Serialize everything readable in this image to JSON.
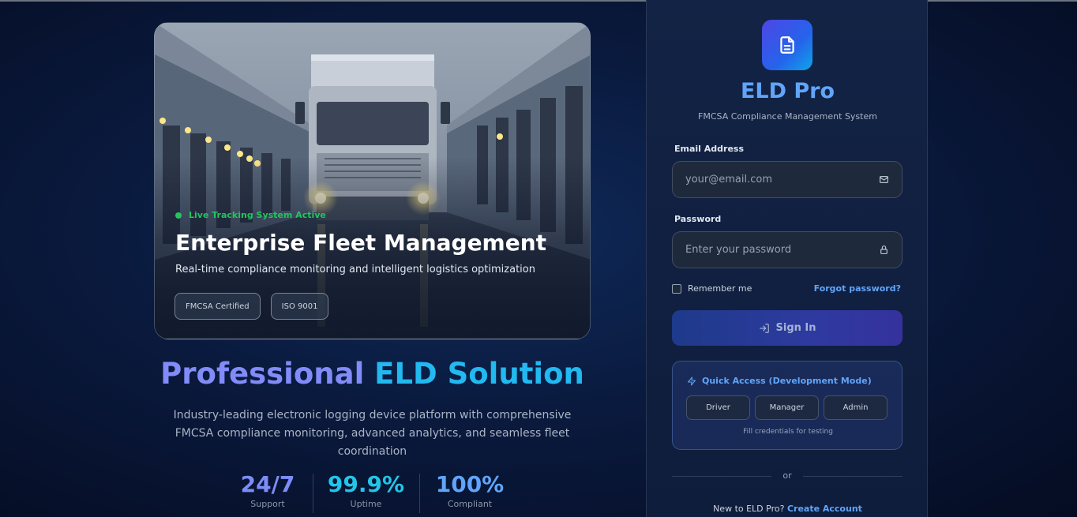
{
  "hero": {
    "live_status": "Live Tracking System Active",
    "title": "Enterprise Fleet Management",
    "subtitle": "Real-time compliance monitoring and intelligent logistics optimization",
    "badges": [
      "FMCSA Certified",
      "ISO 9001"
    ],
    "image": "truck-in-warehouse-photo"
  },
  "main": {
    "title_part1": "Professional",
    "title_part2": "ELD Solution",
    "description": "Industry-leading electronic logging device platform with comprehensive FMCSA compliance monitoring, advanced analytics, and seamless fleet coordination",
    "stats": [
      {
        "value": "24/7",
        "label": "Support"
      },
      {
        "value": "99.9%",
        "label": "Uptime"
      },
      {
        "value": "100%",
        "label": "Compliant"
      }
    ]
  },
  "login": {
    "logo_icon": "document-icon",
    "brand": "ELD Pro",
    "tagline": "FMCSA Compliance Management System",
    "email_label": "Email Address",
    "email_placeholder": "your@email.com",
    "email_icon": "mail-icon",
    "password_label": "Password",
    "password_placeholder": "Enter your password",
    "password_icon": "lock-icon",
    "remember_label": "Remember me",
    "forgot_label": "Forgot password?",
    "signin_label": "Sign In",
    "signin_icon": "login-icon",
    "quick": {
      "title": "Quick Access (Development Mode)",
      "icon": "lightning-icon",
      "buttons": [
        "Driver",
        "Manager",
        "Admin"
      ],
      "note": "Fill credentials for testing"
    },
    "or_label": "or",
    "new_prompt": "New to ELD Pro?",
    "create_label": "Create Account"
  },
  "colors": {
    "accent_blue": "#60a5fa",
    "accent_indigo": "#818cf8",
    "accent_cyan": "#22b8f0",
    "live_green": "#22c55e",
    "bg_dark": "#0a1a3e"
  }
}
